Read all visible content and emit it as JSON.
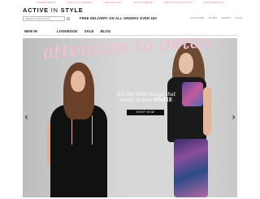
{
  "promo": {
    "items": [
      "SUMMER READY",
      "NEW IN ACTIVEWEAR",
      "FREE DELIVERY",
      "SHOP BY BRAND",
      "NEW FAVOURITE LOOKS",
      "NEW SWIMWEAR"
    ]
  },
  "logo": {
    "part1": "ACTIVE",
    "part2": "IN",
    "part3": "STYLE"
  },
  "search": {
    "placeholder": "SEARCH ACTIVE IN STYLE"
  },
  "free_delivery": "FREE DELIVERY ON ALL ORDERS OVER £60",
  "account_links": [
    "MY ACCOUNT",
    "MY BAG",
    "CONTACT",
    "LOG IN"
  ],
  "nav": {
    "items": [
      "NEW IN",
      "LOOKBOOK",
      "SALE",
      "BLOG"
    ]
  },
  "hero": {
    "headline": "attention to detail",
    "tagline_line1": "It's the little things that",
    "tagline_line2": "count in new",
    "tagline_brand": "ONZIE",
    "cta": "SHOP NOW",
    "prev_arrow": "‹",
    "next_arrow": "›"
  },
  "colors": {
    "accent_pink": "#e0709a",
    "headline_pink": "#f0c5d8",
    "cta_bg": "#111111"
  },
  "icons": {
    "search": "search-icon",
    "prev": "chevron-left-icon",
    "next": "chevron-right-icon"
  }
}
